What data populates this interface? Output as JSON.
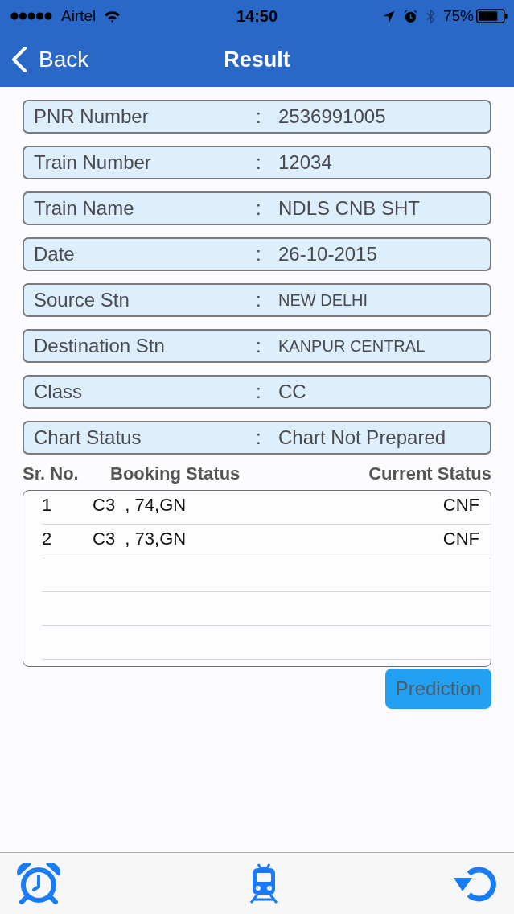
{
  "status_bar": {
    "carrier": "Airtel",
    "time": "14:50",
    "battery": "75%"
  },
  "nav_bar": {
    "back": "Back",
    "title": "Result"
  },
  "details": [
    {
      "label": "PNR Number",
      "separator": ":",
      "value": "2536991005",
      "kind": "large"
    },
    {
      "label": "Train Number",
      "separator": ":",
      "value": "12034",
      "kind": "large"
    },
    {
      "label": "Train Name",
      "separator": ":",
      "value": "NDLS CNB SHT",
      "kind": "large"
    },
    {
      "label": "Date",
      "separator": ":",
      "value": "26-10-2015",
      "kind": "large"
    },
    {
      "label": "Source Stn",
      "separator": ":",
      "value": "NEW DELHI",
      "kind": "small"
    },
    {
      "label": "Destination Stn",
      "separator": ":",
      "value": "KANPUR CENTRAL",
      "kind": "small"
    },
    {
      "label": "Class",
      "separator": ":",
      "value": "CC",
      "kind": "large"
    },
    {
      "label": "Chart Status",
      "separator": ":",
      "value": "Chart Not Prepared",
      "kind": "large"
    }
  ],
  "passenger_table": {
    "columns": [
      "Sr. No.",
      "Booking Status",
      "Current Status"
    ],
    "rows": [
      {
        "sr_no": "1",
        "booking_status": "C3  , 74,GN",
        "current_status": "CNF"
      },
      {
        "sr_no": "2",
        "booking_status": "C3  , 73,GN",
        "current_status": "CNF"
      }
    ]
  },
  "prediction_button": "Prediction"
}
